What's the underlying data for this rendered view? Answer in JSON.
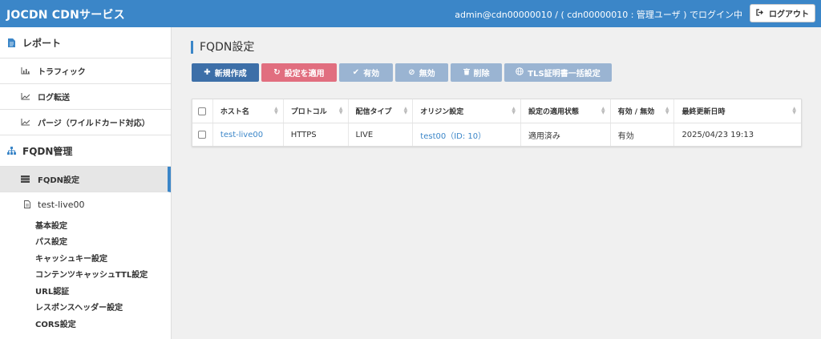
{
  "header": {
    "brand": "JOCDN CDNサービス",
    "user_info": "admin@cdn00000010 / ( cdn00000010 : 管理ユーザ ) でログイン中",
    "logout_label": "ログアウト"
  },
  "sidebar": {
    "report_section": "レポート",
    "report_items": [
      "トラフィック",
      "ログ転送",
      "パージ（ワイルドカード対応）"
    ],
    "fqdn_section": "FQDN管理",
    "fqdn_settings_label": "FQDN設定",
    "resource_name": "test-live00",
    "sub_items": [
      "基本設定",
      "パス設定",
      "キャッシュキー設定",
      "コンテンツキャッシュTTL設定",
      "URL認証",
      "レスポンスヘッダー設定",
      "CORS設定"
    ]
  },
  "main": {
    "title": "FQDN設定",
    "buttons": {
      "new": "新規作成",
      "apply": "設定を適用",
      "enable": "有効",
      "disable": "無効",
      "delete": "削除",
      "tls": "TLS証明書一括設定"
    },
    "columns": [
      "ホスト名",
      "プロトコル",
      "配信タイプ",
      "オリジン設定",
      "設定の適用状態",
      "有効 / 無効",
      "最終更新日時"
    ],
    "rows": [
      {
        "host": "test-live00",
        "protocol": "HTTPS",
        "delivery_type": "LIVE",
        "origin": "test00（ID: 10）",
        "apply_status": "適用済み",
        "enabled": "有効",
        "updated": "2025/04/23 19:13"
      }
    ]
  },
  "colors": {
    "topbar": "#3b86c8",
    "primary_button": "#3d6fa8",
    "apply_button": "#e16e7f",
    "disabled_button": "#9ab4d2",
    "link": "#3b86c8"
  },
  "icons": {
    "report": "document-icon",
    "traffic": "bar-chart-icon",
    "log": "line-chart-icon",
    "purge": "line-chart-icon",
    "fqdn": "sitemap-icon",
    "fqdn_settings": "server-icon",
    "resource": "file-icon",
    "logout": "sign-out-icon"
  }
}
